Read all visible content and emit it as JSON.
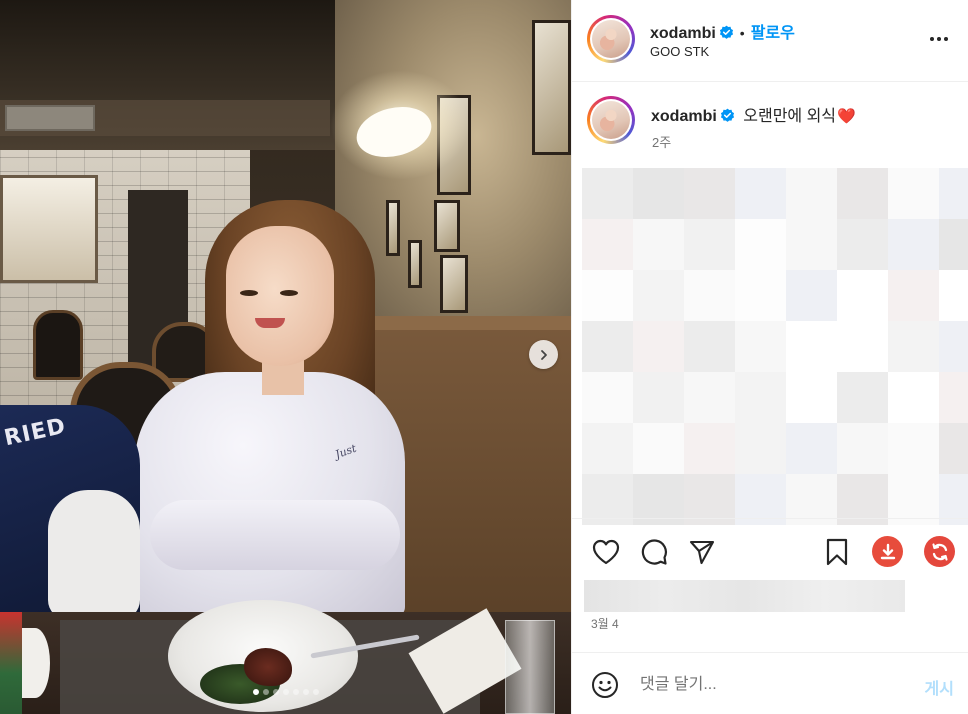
{
  "post": {
    "username": "xodambi",
    "verified": true,
    "dot": "•",
    "follow_label": "팔로우",
    "location": "GOO STK",
    "more_icon": "more-horizontal-icon"
  },
  "caption": {
    "username": "xodambi",
    "text": "오랜만에 외식",
    "emoji": "❤️",
    "time_ago": "2주"
  },
  "photo": {
    "jacket_text": "RIED",
    "shirt_print": "Just",
    "carousel_total": 7,
    "carousel_active": 1
  },
  "actions": {
    "like_icon": "heart-icon",
    "comment_icon": "comment-bubble-icon",
    "share_icon": "paper-plane-icon",
    "save_icon": "bookmark-icon",
    "download_icon": "download-icon",
    "repost_icon": "refresh-icon"
  },
  "date": "3월 4",
  "comment": {
    "placeholder": "댓글 달기...",
    "post_label": "게시"
  },
  "colors": {
    "accent": "#0095f6",
    "post_disabled": "#b2dffc",
    "download_red": "#e74c3c",
    "repost_red": "#e4473c"
  }
}
